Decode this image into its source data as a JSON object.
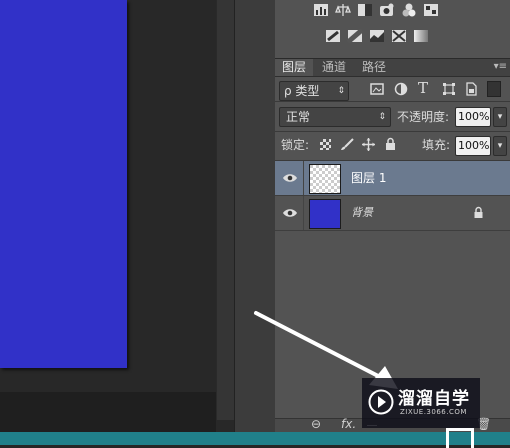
{
  "layers_panel": {
    "tabs": [
      {
        "label": "图层",
        "active": true
      },
      {
        "label": "通道",
        "active": false
      },
      {
        "label": "路径",
        "active": false
      }
    ],
    "filter_kind": "ρ 类型",
    "blend_mode": "正常",
    "opacity_label": "不透明度:",
    "opacity_value": "100%",
    "lock_label": "锁定:",
    "fill_label": "填充:",
    "fill_value": "100%",
    "layers": [
      {
        "name": "图层 1",
        "selected": true,
        "thumb": "transparent"
      },
      {
        "name": "背景",
        "selected": false,
        "thumb": "#3131c8",
        "locked": true
      }
    ],
    "bottom_icons": [
      "link-icon",
      "fx-icon"
    ],
    "fx_label": "fx."
  },
  "canvas": {
    "document_color": "#3131c8"
  },
  "watermark": {
    "title": "溜溜自学",
    "url": "ZIXUE.3066.COM"
  },
  "colors": {
    "panel": "#535353",
    "selected_row": "#6b7a8f",
    "status": "#20808a"
  }
}
